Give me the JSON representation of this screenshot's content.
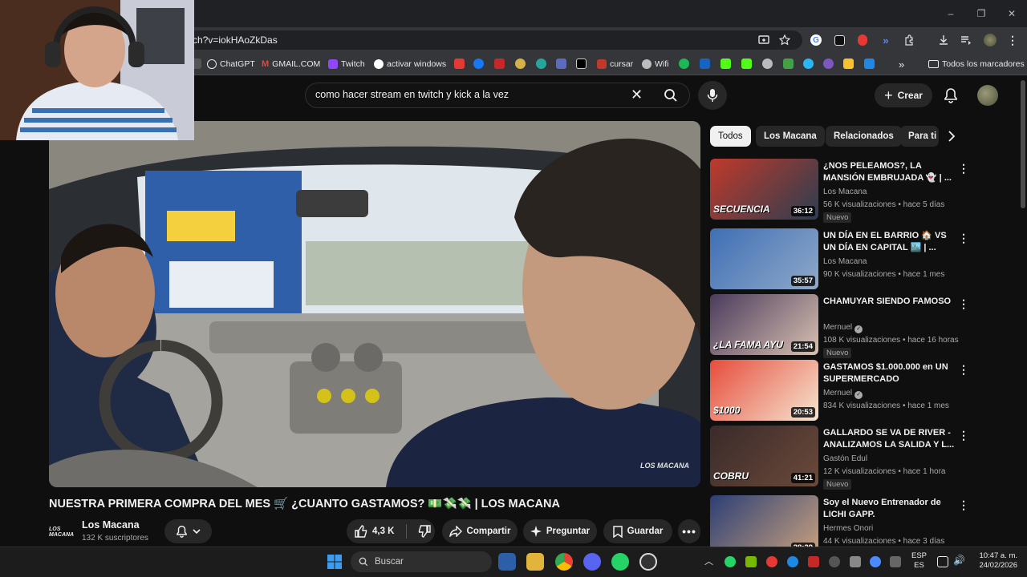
{
  "browser": {
    "url": "ch?v=iokHAoZkDas",
    "window_controls": [
      "–",
      "❐",
      "✕"
    ],
    "bookmarks": [
      {
        "label": "ChatGPT",
        "color": "#e8eaed"
      },
      {
        "label": "GMAIL.COM",
        "color": "#ea4335"
      },
      {
        "label": "Twitch",
        "color": "#9146ff"
      },
      {
        "label": "activar windows",
        "color": "#ffffff"
      },
      {
        "label": "cursar",
        "color": "#c0392b"
      },
      {
        "label": "Wifi",
        "color": "#bdbdbd"
      }
    ],
    "bookmarks_overflow": "»",
    "all_bookmarks_label": "Todos los marcadores"
  },
  "youtube": {
    "search_query": "como hacer stream en twitch y kick a la vez",
    "create_label": "Crear",
    "video": {
      "title": "NUESTRA PRIMERA COMPRA DEL MES 🛒 ¿CUANTO GASTAMOS? 💵💸💸 | LOS MACANA",
      "watermark": "LOS MACANA",
      "channel_logo_text": "LOS MACANA",
      "channel_name": "Los Macana",
      "subscribers": "132 K suscriptores",
      "likes": "4,3 K",
      "share_label": "Compartir",
      "ask_label": "Preguntar",
      "save_label": "Guardar"
    },
    "chips": [
      "Todos",
      "Los Macana",
      "Relacionados",
      "Para ti"
    ],
    "recommendations": [
      {
        "title": "¿NOS PELEAMOS?, LA MANSIÓN EMBRUJADA 👻 | ...",
        "channel": "Los Macana",
        "verified": false,
        "stats": "56 K visualizaciones • hace 5 días",
        "duration": "36:12",
        "badge": "Nuevo",
        "thumb_text": "SECUENCIA",
        "thumb_colors": [
          "#c0392b",
          "#2c3e50"
        ]
      },
      {
        "title": "UN DÍA EN EL BARRIO 🏠 VS UN DÍA EN CAPITAL 🏙️ | ...",
        "channel": "Los Macana",
        "verified": false,
        "stats": "90 K visualizaciones • hace 1 mes",
        "duration": "35:57",
        "badge": "",
        "thumb_text": "",
        "thumb_colors": [
          "#3f6fb5",
          "#8fa9c8"
        ]
      },
      {
        "title": "CHAMUYAR SIENDO FAMOSO",
        "channel": "Mernuel",
        "verified": true,
        "stats": "108 K visualizaciones • hace 16 horas",
        "duration": "21:54",
        "badge": "Nuevo",
        "thumb_text": "¿LA FAMA AYU",
        "thumb_colors": [
          "#4a3b5c",
          "#d8c0b0"
        ]
      },
      {
        "title": "GASTAMOS $1.000.000 en UN SUPERMERCADO",
        "channel": "Mernuel",
        "verified": true,
        "stats": "834 K visualizaciones • hace 1 mes",
        "duration": "20:53",
        "badge": "",
        "thumb_text": "$1000",
        "thumb_colors": [
          "#e74c3c",
          "#f5e6d0"
        ]
      },
      {
        "title": "GALLARDO SE VA DE RIVER - ANALIZAMOS LA SALIDA Y L...",
        "channel": "Gastón Edul",
        "verified": false,
        "stats": "12 K visualizaciones • hace 1 hora",
        "duration": "41:21",
        "badge": "Nuevo",
        "thumb_text": "COBRU",
        "thumb_colors": [
          "#3a2a2a",
          "#6b4a3a"
        ]
      },
      {
        "title": "Soy el Nuevo Entrenador de LICHI GAPP.",
        "channel": "Hermes Onori",
        "verified": false,
        "stats": "44 K visualizaciones • hace 3 días",
        "duration": "38:29",
        "badge": "",
        "thumb_text": "",
        "thumb_colors": [
          "#2c3e75",
          "#c9a27e"
        ]
      }
    ]
  },
  "taskbar": {
    "search_label": "Buscar",
    "lang_top": "ESP",
    "lang_bottom": "ES",
    "time": "10:47 a. m.",
    "date": "24/02/2026"
  }
}
